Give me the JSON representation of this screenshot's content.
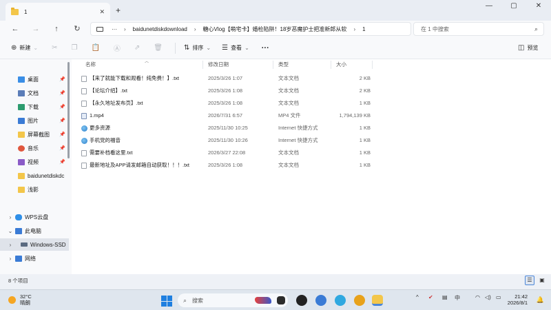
{
  "window": {
    "tab_title": "1",
    "tab_close": "✕",
    "new_tab": "+",
    "minimize": "—",
    "maximize": "▢",
    "close": "✕"
  },
  "nav": {
    "back": "←",
    "forward": "→",
    "up": "↑",
    "refresh": "↻",
    "more": "···",
    "breadcrumb": [
      "baidunetdiskdownload",
      "糖心Vlog【萌宅卡】婚检陷阱！18岁恶魔护士把准新郎从软",
      "1"
    ],
    "separator": "›",
    "search_placeholder": "在 1 中搜索"
  },
  "toolbar": {
    "new": "新建",
    "sort": "排序",
    "view": "查看",
    "more": "···",
    "preview": "预览"
  },
  "sidebar": {
    "items": [
      {
        "label": "桌面",
        "color": "#3a8ee6"
      },
      {
        "label": "文档",
        "color": "#5b7db8"
      },
      {
        "label": "下载",
        "color": "#2d9c6f"
      },
      {
        "label": "图片",
        "color": "#3a7bd5"
      },
      {
        "label": "屏幕截图",
        "color": "#f3c64a"
      },
      {
        "label": "音乐",
        "color": "#e0573e"
      },
      {
        "label": "视频",
        "color": "#8b5cc7"
      },
      {
        "label": "baidunetdiskdc",
        "color": "#f3c64a"
      },
      {
        "label": "浅影",
        "color": "#f3c64a"
      }
    ],
    "pin": "📌",
    "tree": [
      {
        "label": "WPS云盘",
        "chevron": "›",
        "color": "#2f8fe8"
      },
      {
        "label": "此电脑",
        "chevron": "⌄",
        "color": "#3a7bd5"
      },
      {
        "label": "Windows-SSD",
        "chevron": "›",
        "color": "#5a6a80"
      },
      {
        "label": "网络",
        "chevron": "›",
        "color": "#3a7bd5"
      }
    ]
  },
  "columns": {
    "name": "名称",
    "date": "修改日期",
    "type": "类型",
    "size": "大小"
  },
  "files": [
    {
      "name": "【来了就能下载和观看！纯免费！】.txt",
      "date": "2025/3/26 1:07",
      "type": "文本文档",
      "size": "2 KB",
      "icon": "txt"
    },
    {
      "name": "【论坛介绍】.txt",
      "date": "2025/3/26 1:08",
      "type": "文本文档",
      "size": "2 KB",
      "icon": "txt"
    },
    {
      "name": "【永久地址发布页】.txt",
      "date": "2025/3/26 1:08",
      "type": "文本文档",
      "size": "1 KB",
      "icon": "txt"
    },
    {
      "name": "1.mp4",
      "date": "2026/7/31 6:57",
      "type": "MP4 文件",
      "size": "1,794,139 KB",
      "icon": "mp4"
    },
    {
      "name": "更多资源",
      "date": "2025/11/30 10:25",
      "type": "Internet 快捷方式",
      "size": "1 KB",
      "icon": "url"
    },
    {
      "name": "手机党的福音",
      "date": "2025/11/30 10:26",
      "type": "Internet 快捷方式",
      "size": "1 KB",
      "icon": "url"
    },
    {
      "name": "需要补档看这里.txt",
      "date": "2026/3/27 22:08",
      "type": "文本文档",
      "size": "1 KB",
      "icon": "txt"
    },
    {
      "name": "最新地址及APP请发邮箱自动获取！！！.txt",
      "date": "2025/3/26 1:08",
      "type": "文本文档",
      "size": "1 KB",
      "icon": "txt"
    }
  ],
  "status": {
    "count": "8 个项目"
  },
  "taskbar": {
    "temp": "32°C",
    "weather": "晴朗",
    "search": "搜索",
    "time": "21:42",
    "date": "2026/8/1",
    "tray_arrow": "^",
    "wifi": "◠",
    "volume": "◁)",
    "battery": "▭"
  }
}
